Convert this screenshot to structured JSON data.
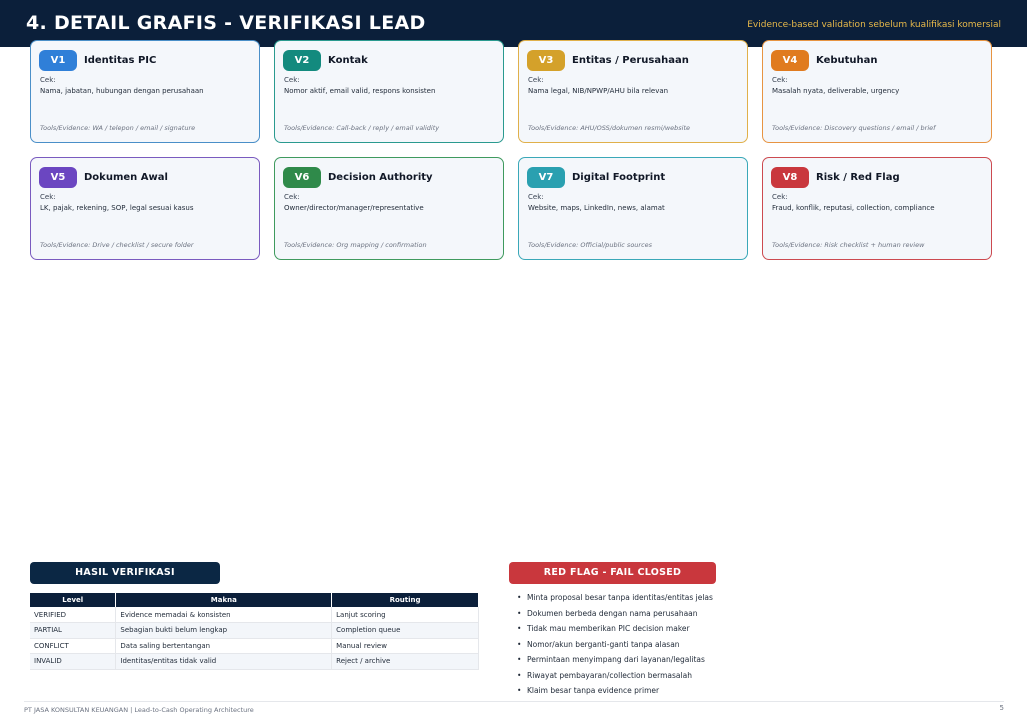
{
  "header": {
    "title": "4. DETAIL GRAFIS - VERIFIKASI LEAD",
    "subtitle": "Evidence-based validation sebelum kualifikasi komersial"
  },
  "cards": [
    {
      "code": "V1",
      "title": "Identitas PIC",
      "cek": "Cek:",
      "desc": "Nama, jabatan, hubungan dengan perusahaan",
      "tools": "Tools/Evidence: WA / telepon / email / signature",
      "color": "#2f7fd8",
      "border": "#4a8fc8"
    },
    {
      "code": "V2",
      "title": "Kontak",
      "cek": "Cek:",
      "desc": "Nomor aktif, email valid, respons konsisten",
      "tools": "Tools/Evidence: Call-back / reply / email validity",
      "color": "#138a7e",
      "border": "#2a9a8f"
    },
    {
      "code": "V3",
      "title": "Entitas / Perusahaan",
      "cek": "Cek:",
      "desc": "Nama legal, NIB/NPWP/AHU bila relevan",
      "tools": "Tools/Evidence: AHU/OSS/dokumen resmi/website",
      "color": "#d4a12a",
      "border": "#e0b04a"
    },
    {
      "code": "V4",
      "title": "Kebutuhan",
      "cek": "Cek:",
      "desc": "Masalah nyata, deliverable, urgency",
      "tools": "Tools/Evidence: Discovery questions / email / brief",
      "color": "#e07b1f",
      "border": "#e79442"
    },
    {
      "code": "V5",
      "title": "Dokumen Awal",
      "cek": "Cek:",
      "desc": "LK, pajak, rekening, SOP, legal sesuai kasus",
      "tools": "Tools/Evidence: Drive / checklist / secure folder",
      "color": "#6b46c1",
      "border": "#7a5bbf"
    },
    {
      "code": "V6",
      "title": "Decision Authority",
      "cek": "Cek:",
      "desc": "Owner/director/manager/representative",
      "tools": "Tools/Evidence: Org mapping / confirmation",
      "color": "#2f8a4a",
      "border": "#3f9a5e"
    },
    {
      "code": "V7",
      "title": "Digital Footprint",
      "cek": "Cek:",
      "desc": "Website, maps, LinkedIn, news, alamat",
      "tools": "Tools/Evidence: Official/public sources",
      "color": "#2aa0b0",
      "border": "#3aa8b8"
    },
    {
      "code": "V8",
      "title": "Risk / Red Flag",
      "cek": "Cek:",
      "desc": "Fraud, konflik, reputasi, collection, compliance",
      "tools": "Tools/Evidence: Risk checklist + human review",
      "color": "#c9373d",
      "border": "#cc4a50"
    }
  ],
  "hasil": {
    "label": "HASIL VERIFIKASI",
    "headers": [
      "Level",
      "Makna",
      "Routing"
    ],
    "rows": [
      [
        "VERIFIED",
        "Evidence memadai & konsisten",
        "Lanjut scoring"
      ],
      [
        "PARTIAL",
        "Sebagian bukti belum lengkap",
        "Completion queue"
      ],
      [
        "CONFLICT",
        "Data saling bertentangan",
        "Manual review"
      ],
      [
        "INVALID",
        "Identitas/entitas tidak valid",
        "Reject / archive"
      ]
    ]
  },
  "redflag": {
    "label": "RED FLAG - FAIL CLOSED",
    "bullet": "•",
    "items": [
      "Minta proposal besar tanpa identitas/entitas jelas",
      "Dokumen berbeda dengan nama perusahaan",
      "Tidak mau memberikan PIC decision maker",
      "Nomor/akun berganti-ganti tanpa alasan",
      "Permintaan menyimpang dari layanan/legalitas",
      "Riwayat pembayaran/collection bermasalah",
      "Klaim besar tanpa evidence primer"
    ]
  },
  "footer": {
    "text": "PT JASA KONSULTAN KEUANGAN | Lead-to-Cash Operating Architecture",
    "page": "5"
  }
}
